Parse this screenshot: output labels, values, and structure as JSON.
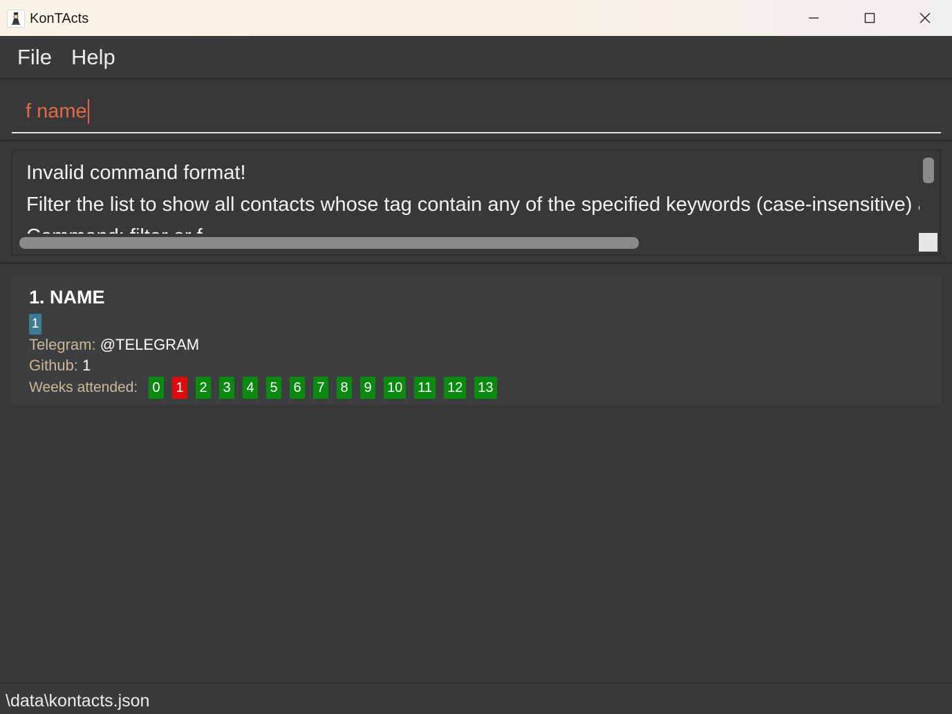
{
  "window": {
    "title": "KonTActs",
    "controls": {
      "minimize_icon": "minimize-icon",
      "maximize_icon": "maximize-icon",
      "close_icon": "close-icon"
    }
  },
  "menu": {
    "items": [
      {
        "label": "File"
      },
      {
        "label": "Help"
      }
    ]
  },
  "command": {
    "value": "f name",
    "text_color": "#e06a4a"
  },
  "result": {
    "lines": [
      "Invalid command format!",
      "Filter the list to show all contacts whose tag contain any of the specified keywords (case-insensitive) an",
      "Command: filter or f"
    ]
  },
  "persons": [
    {
      "index_name": "1. NAME",
      "tags": [
        "1"
      ],
      "telegram_label": "Telegram:",
      "telegram_value": "@TELEGRAM",
      "github_label": "Github:",
      "github_value": "1",
      "weeks_label": "Weeks attended:",
      "weeks": [
        {
          "label": "0",
          "status": "attended"
        },
        {
          "label": "1",
          "status": "absent"
        },
        {
          "label": "2",
          "status": "attended"
        },
        {
          "label": "3",
          "status": "attended"
        },
        {
          "label": "4",
          "status": "attended"
        },
        {
          "label": "5",
          "status": "attended"
        },
        {
          "label": "6",
          "status": "attended"
        },
        {
          "label": "7",
          "status": "attended"
        },
        {
          "label": "8",
          "status": "attended"
        },
        {
          "label": "9",
          "status": "attended"
        },
        {
          "label": "10",
          "status": "attended"
        },
        {
          "label": "11",
          "status": "attended"
        },
        {
          "label": "12",
          "status": "attended"
        },
        {
          "label": "13",
          "status": "attended"
        }
      ]
    }
  ],
  "status_bar": {
    "path": "\\data\\kontacts.json"
  },
  "colors": {
    "attended": "#0b8a12",
    "absent": "#e20b0b",
    "tag": "#3e7b91",
    "label": "#c8b99a"
  }
}
